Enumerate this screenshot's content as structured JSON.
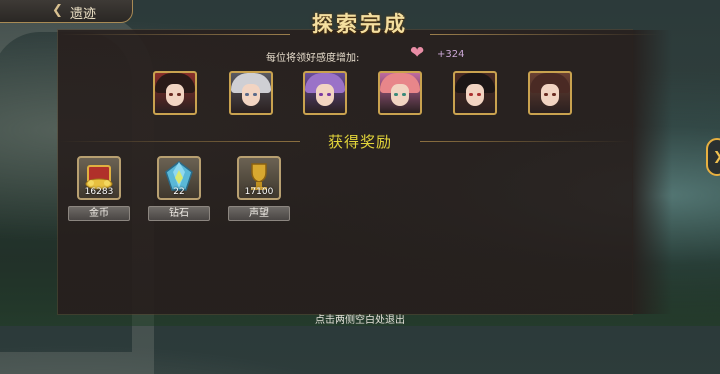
{
  "header": {
    "back_label": "遗迹",
    "back_icon": "back-arrow-icon"
  },
  "title": "探索完成",
  "affection": {
    "label": "每位将领好感度增加:",
    "icon": "heart-icon",
    "value": "+324",
    "heart_color": "#e98ea6"
  },
  "portraits": [
    {
      "name": "general-1",
      "hair": "#2a1a18",
      "bg": "#8a2f2a",
      "eye": "#6a2a20"
    },
    {
      "name": "general-2",
      "hair": "#cfcfd4",
      "bg": "#5a5a62",
      "eye": "#5a6a8a"
    },
    {
      "name": "general-3",
      "hair": "#9a72c8",
      "bg": "#6a4e9a",
      "eye": "#7a3aa0"
    },
    {
      "name": "general-4",
      "hair": "#e8868a",
      "bg": "#c06aa0",
      "eye": "#3a8a7a"
    },
    {
      "name": "general-5",
      "hair": "#1c1616",
      "bg": "#4a2a22",
      "eye": "#aa3030"
    },
    {
      "name": "general-6",
      "hair": "#4a2a24",
      "bg": "#6a4032",
      "eye": "#6a2a20"
    }
  ],
  "reward_title": "获得奖励",
  "rewards": [
    {
      "label": "金币",
      "quantity": "16283",
      "icon": "gold-coin-chest-icon"
    },
    {
      "label": "钻石",
      "quantity": "22",
      "icon": "diamond-crystal-icon"
    },
    {
      "label": "声望",
      "quantity": "17100",
      "icon": "prestige-trophy-icon"
    }
  ],
  "exit_hint": "点击两侧空白处退出",
  "colors": {
    "title": "#f4dfa0",
    "reward_title": "#e2d43a",
    "frame_gold": "#c9a24f"
  }
}
